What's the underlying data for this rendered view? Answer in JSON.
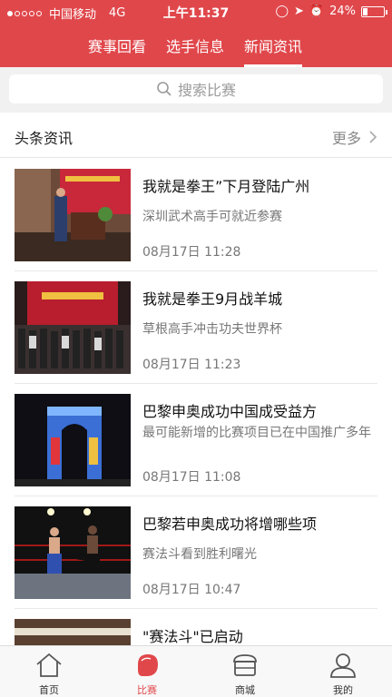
{
  "status_bar": {
    "carrier": "中国移动",
    "network": "4G",
    "time": "上午11:37",
    "battery_percent": "24%",
    "battery_level": 0.24
  },
  "nav": {
    "tabs": [
      {
        "label": "赛事回看",
        "active": false
      },
      {
        "label": "选手信息",
        "active": false
      },
      {
        "label": "新闻资讯",
        "active": true
      }
    ]
  },
  "search": {
    "placeholder": "搜索比赛"
  },
  "section": {
    "title": "头条资讯",
    "more": "更多"
  },
  "news": [
    {
      "title": "我就是拳王”下月登陆广州",
      "desc": "深圳武术高手可就近参赛",
      "time": "08月17日 11:28"
    },
    {
      "title": "我就是拳王9月战羊城",
      "desc": "草根高手冲击功夫世界杯",
      "time": "08月17日 11:23"
    },
    {
      "title": "巴黎申奥成功中国成受益方",
      "desc": "最可能新增的比赛项目已在中国推广多年",
      "time": "08月17日 11:08"
    },
    {
      "title": "巴黎若申奥成功将增哪些项",
      "desc": "赛法斗看到胜利曙光",
      "time": "08月17日 10:47"
    },
    {
      "title": "\"赛法斗\"已启动",
      "desc": "",
      "time": ""
    }
  ],
  "tabbar": {
    "items": [
      {
        "label": "首页",
        "icon": "home-icon",
        "active": false
      },
      {
        "label": "比赛",
        "icon": "boxing-glove-icon",
        "active": true
      },
      {
        "label": "商城",
        "icon": "shop-icon",
        "active": false
      },
      {
        "label": "我的",
        "icon": "user-icon",
        "active": false
      }
    ]
  },
  "colors": {
    "brand": "#e0474b",
    "text": "#111111",
    "muted": "#777777"
  }
}
